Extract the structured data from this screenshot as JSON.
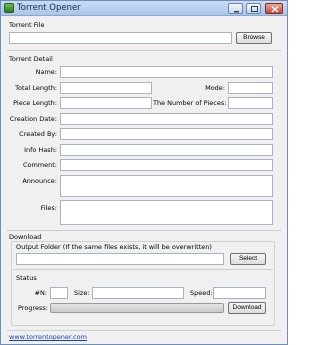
{
  "window": {
    "title": "Torrent Opener"
  },
  "torrent_file": {
    "section_label": "Torrent File",
    "path_value": "",
    "browse_label": "Browse"
  },
  "torrent_detail": {
    "section_label": "Torrent Detail",
    "name_label": "Name:",
    "total_length_label": "Total Length:",
    "mode_label": "Mode:",
    "piece_length_label": "Piece Length:",
    "number_of_pieces_label": "The Number of Pieces:",
    "creation_date_label": "Creation Date:",
    "created_by_label": "Created By:",
    "info_hash_label": "Info Hash:",
    "comment_label": "Comment:",
    "announce_label": "Announce:",
    "files_label": "Files:"
  },
  "download": {
    "section_label": "Download",
    "output_folder_label": "Output Folder (If the same files exists, it will be overwritten)",
    "output_folder_value": "",
    "select_label": "Select",
    "status_label": "Status",
    "n_label": "#N:",
    "size_label": "Size:",
    "speed_label": "Speed:",
    "progress_label": "Progress:",
    "progress_fraction": 0,
    "download_button_label": "Download"
  },
  "footer": {
    "link_text": "www.torrentopener.com"
  },
  "colors": {
    "link": "#1c40c4",
    "titlebar_top": "#c9dcf5",
    "titlebar_bottom": "#aac6ea"
  }
}
